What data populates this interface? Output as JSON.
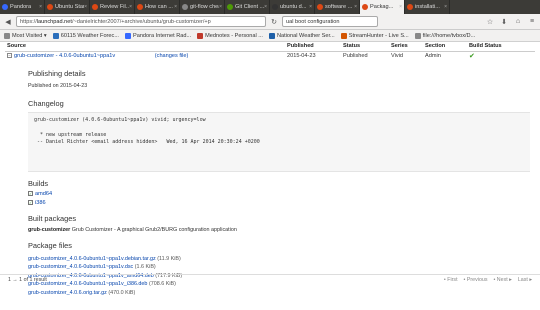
{
  "browser": {
    "tabs": [
      {
        "label": "Pandora",
        "icon_color": "#3668ff"
      },
      {
        "label": "Ubuntu Start ...",
        "icon_color": "#dd4814"
      },
      {
        "label": "Review Fil...",
        "icon_color": "#dd4814"
      },
      {
        "label": "How can ...",
        "icon_color": "#dd4814"
      },
      {
        "label": "git-flow chea...",
        "icon_color": "#888888"
      },
      {
        "label": "Git Client ...",
        "icon_color": "#4e9a06"
      },
      {
        "label": "ubuntu d...",
        "icon_color": "#333333"
      },
      {
        "label": "software ...",
        "icon_color": "#dd4814"
      },
      {
        "label": "Packag...",
        "icon_color": "#dd4814",
        "active": true
      },
      {
        "label": "installati...",
        "icon_color": "#dd4814"
      }
    ],
    "url_prefix": "https://",
    "url_host": "launchpad.net",
    "url_path": "/~danielrichter2007/+archive/ubuntu/grub-customizer/+p",
    "search_value": "ual boot configuration",
    "bookmarks": [
      {
        "label": "Most Visited ▾",
        "icon_color": "#888888"
      },
      {
        "label": "60115 Weather Forec...",
        "icon_color": "#2a6ebb"
      },
      {
        "label": "Pandora Internet Rad...",
        "icon_color": "#3668ff"
      },
      {
        "label": "Mednotes - Personal ...",
        "icon_color": "#c0392b"
      },
      {
        "label": "National Weather Ser...",
        "icon_color": "#1d5fa8"
      },
      {
        "label": "StreamHunter - Live S...",
        "icon_color": "#d35400"
      },
      {
        "label": "file:///home/tvbox/D...",
        "icon_color": "#888888"
      }
    ]
  },
  "table": {
    "headers": [
      "Source",
      "Published",
      "Status",
      "Series",
      "Section",
      "Build Status"
    ],
    "row": {
      "source": "grub-customizer - 4.0.6-0ubuntu1~ppa1v",
      "changes_link": "(changes file)",
      "published": "2015-04-23",
      "status": "Published",
      "series": "Vivid",
      "section": "Admin"
    }
  },
  "details": {
    "publishing_heading": "Publishing details",
    "published_on": "Published on 2015-04-23",
    "changelog_heading": "Changelog",
    "changelog_text": "grub-customizer (4.0.6-0ubuntu1~ppa1v) vivid; urgency=low\n\n  * new upstream release\n -- Daniel Richter <email address hidden>   Wed, 16 Apr 2014 20:30:24 +0200",
    "builds_heading": "Builds",
    "builds": [
      "amd64",
      "i386"
    ],
    "built_heading": "Built packages",
    "built_name": "grub-customizer",
    "built_desc": "Grub Customizer - A graphical Grub2/BURG configuration application",
    "files_heading": "Package files",
    "files": [
      {
        "name": "grub-customizer_4.0.6-0ubuntu1~ppa1v.debian.tar.gz",
        "size": "(11.9 KiB)"
      },
      {
        "name": "grub-customizer_4.0.6-0ubuntu1~ppa1v.dsc",
        "size": "(1.6 KiB)"
      },
      {
        "name": "grub-customizer_4.0.6-0ubuntu1~ppa1v_amd64.deb",
        "size": "(717.9 KiB)"
      },
      {
        "name": "grub-customizer_4.0.6-0ubuntu1~ppa1v_i386.deb",
        "size": "(708.6 KiB)"
      },
      {
        "name": "grub-customizer_4.0.6.orig.tar.gz",
        "size": "(470.0 KiB)"
      }
    ]
  },
  "footer": {
    "results": "1 → 1 of 1 result",
    "first": "• First",
    "previous": "• Previous",
    "next": "• Next ▸",
    "last": "Last ▸"
  }
}
